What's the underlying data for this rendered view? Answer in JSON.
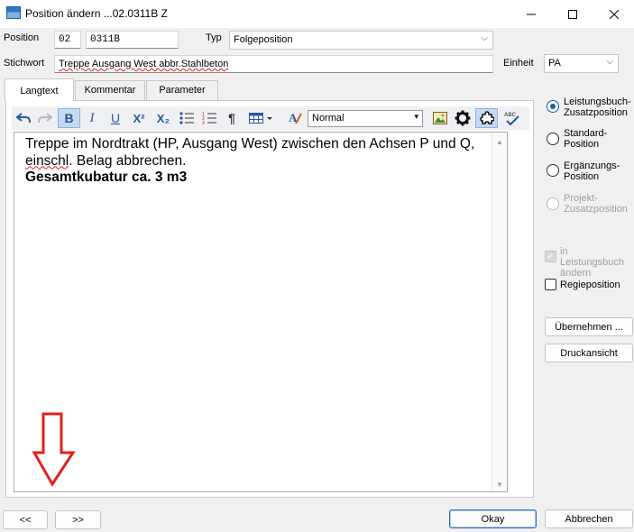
{
  "window": {
    "title": "Position ändern ...02.0311B  Z"
  },
  "header": {
    "position_label": "Position",
    "position_part1": "02",
    "position_part2": "0311B",
    "typ_label": "Typ",
    "typ_value": "Folgeposition",
    "stichwort_label": "Stichwort",
    "stichwort_value": "Treppe Ausgang West abbr.Stahlbeton",
    "einheit_label": "Einheit",
    "einheit_value": "PA"
  },
  "tabs": [
    {
      "label": "Langtext",
      "active": true
    },
    {
      "label": "Kommentar",
      "active": false
    },
    {
      "label": "Parameter",
      "active": false
    }
  ],
  "toolbar": {
    "style_value": "Normal",
    "bold_glyph": "B",
    "italic_glyph": "I",
    "underline_glyph": "U",
    "superscript_glyph": "X²",
    "subscript_glyph": "X₂",
    "paragraph_glyph": "¶"
  },
  "editor": {
    "line1": "Treppe im Nordtrakt (HP, Ausgang West) zwischen den Achsen P und Q,",
    "line2_word": "einschl",
    "line2_rest": ". Belag abbrechen.",
    "line3": "Gesamtkubatur ca. 3 m3"
  },
  "options": {
    "radios": [
      {
        "label": "Leistungsbuch-Zusatzposition",
        "checked": true,
        "enabled": true
      },
      {
        "label": "Standard-Position",
        "checked": false,
        "enabled": true
      },
      {
        "label": "Ergänzungs-Position",
        "checked": false,
        "enabled": true
      },
      {
        "label": "Projekt-Zusatzposition",
        "checked": false,
        "enabled": false
      }
    ],
    "in_lb_aendern_label": "in Leistungsbuch ändern",
    "regieposition_label": "Regieposition"
  },
  "buttons": {
    "uebernehmen": "Übernehmen ...",
    "druckansicht": "Druckansicht",
    "prev": "<<",
    "next": ">>",
    "okay": "Okay",
    "abbrechen": "Abbrechen"
  },
  "colors": {
    "accent": "#1a5fa8",
    "annotation_arrow": "#e0201e",
    "default_button_border": "#2f6fc5"
  }
}
